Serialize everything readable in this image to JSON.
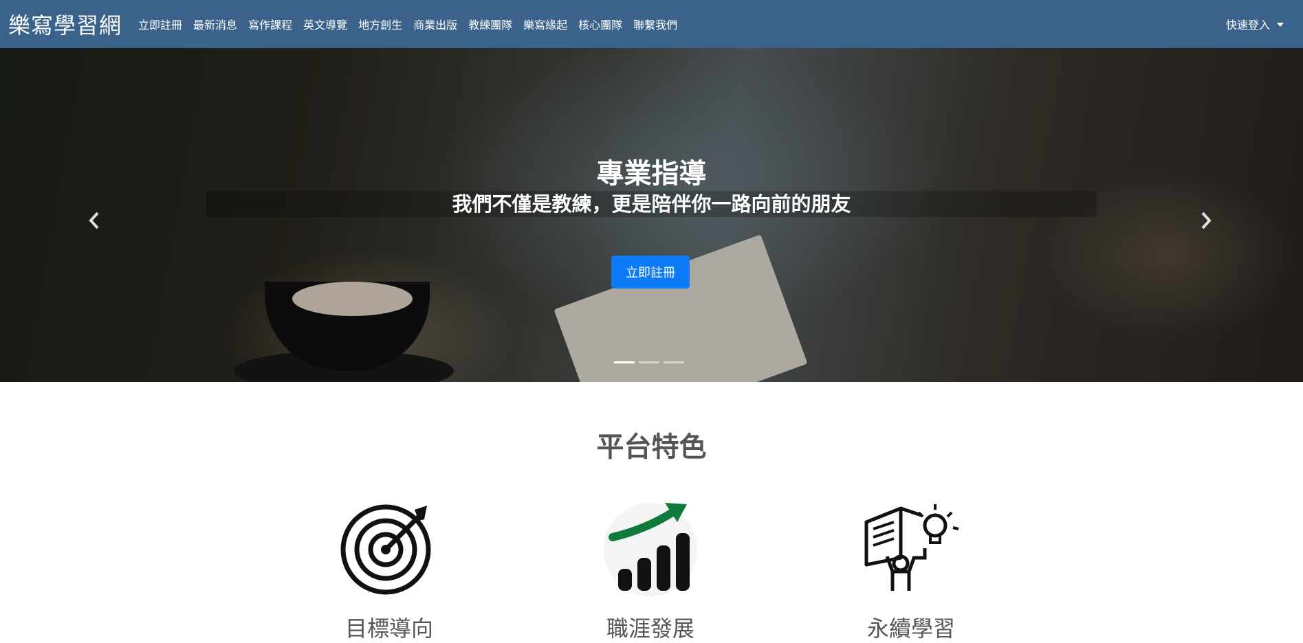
{
  "navbar": {
    "brand": "樂寫學習網",
    "items": [
      {
        "label": "立即註冊"
      },
      {
        "label": "最新消息"
      },
      {
        "label": "寫作課程"
      },
      {
        "label": "英文導覽"
      },
      {
        "label": "地方創生"
      },
      {
        "label": "商業出版"
      },
      {
        "label": "教練團隊"
      },
      {
        "label": "樂寫緣起"
      },
      {
        "label": "核心團隊"
      },
      {
        "label": "聯繫我們"
      }
    ],
    "login_label": "快速登入"
  },
  "hero": {
    "title": "專業指導",
    "subtitle": "我們不僅是教練，更是陪伴你一路向前的朋友",
    "button_label": "立即註冊",
    "prev_icon": "chevron-left-icon",
    "next_icon": "chevron-right-icon",
    "slide_count": 3,
    "active_slide": 1
  },
  "features": {
    "title": "平台特色",
    "items": [
      {
        "label": "目標導向",
        "icon": "target-icon"
      },
      {
        "label": "職涯發展",
        "icon": "growth-chart-icon"
      },
      {
        "label": "永續學習",
        "icon": "reading-idea-icon"
      }
    ]
  },
  "colors": {
    "navbar_bg": "#3a628b",
    "button_bg": "#0d7bf5",
    "growth_arrow": "#0f7a3a"
  }
}
